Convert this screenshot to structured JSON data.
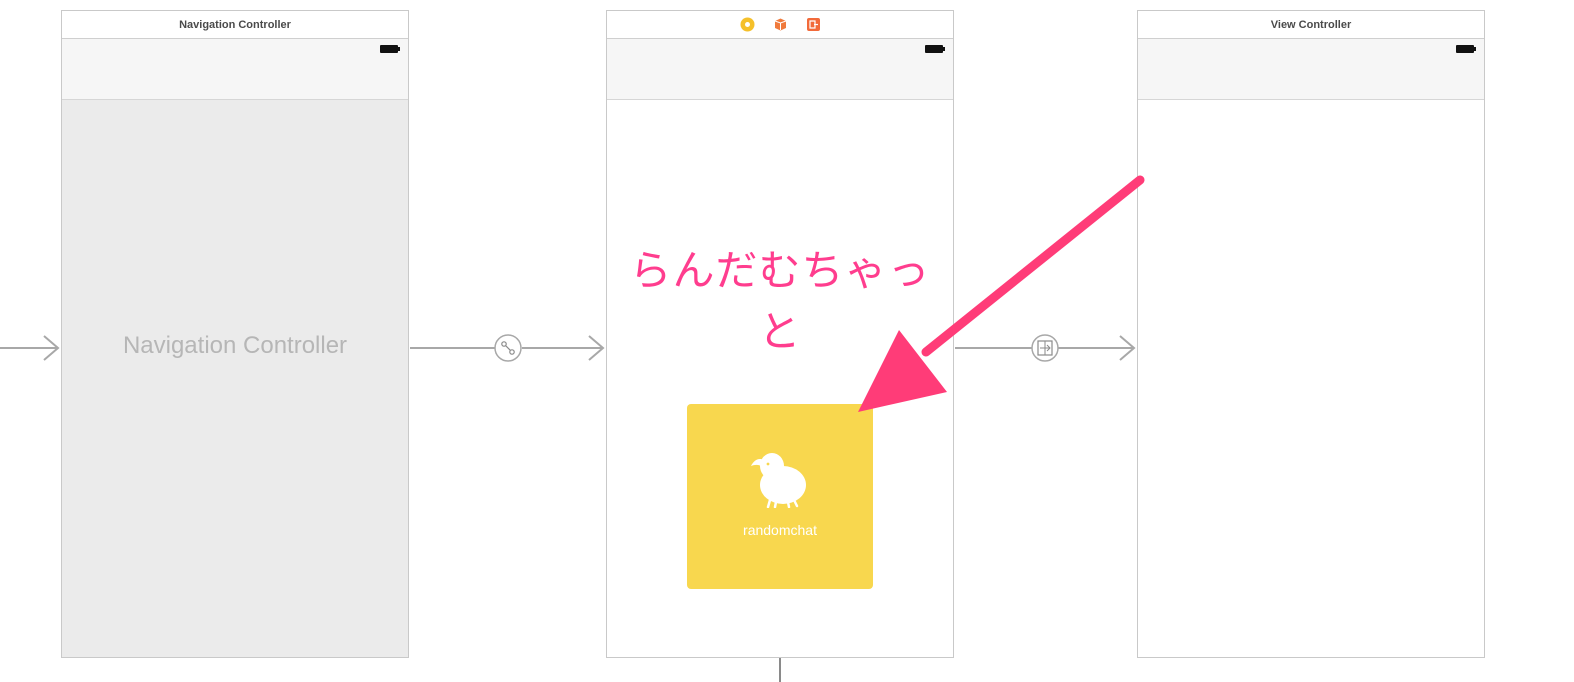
{
  "scenes": {
    "navigation_controller": {
      "title": "Navigation Controller",
      "placeholder_label": "Navigation Controller"
    },
    "main_view": {
      "heading": "らんだむちゃっと",
      "app_tile": {
        "label": "randomchat",
        "color": "#f8d74e"
      }
    },
    "view_controller": {
      "title": "View Controller"
    }
  },
  "icons": {
    "scene_dock": [
      "view-controller-icon",
      "first-responder-icon",
      "exit-icon"
    ],
    "segue_relationship": "relationship-segue-icon",
    "segue_show": "show-segue-icon",
    "chick": "chick-icon"
  },
  "colors": {
    "annotation_arrow": "#ff3c78",
    "heading_text": "#ff3d8e",
    "segue_line": "#a8a8a8"
  }
}
